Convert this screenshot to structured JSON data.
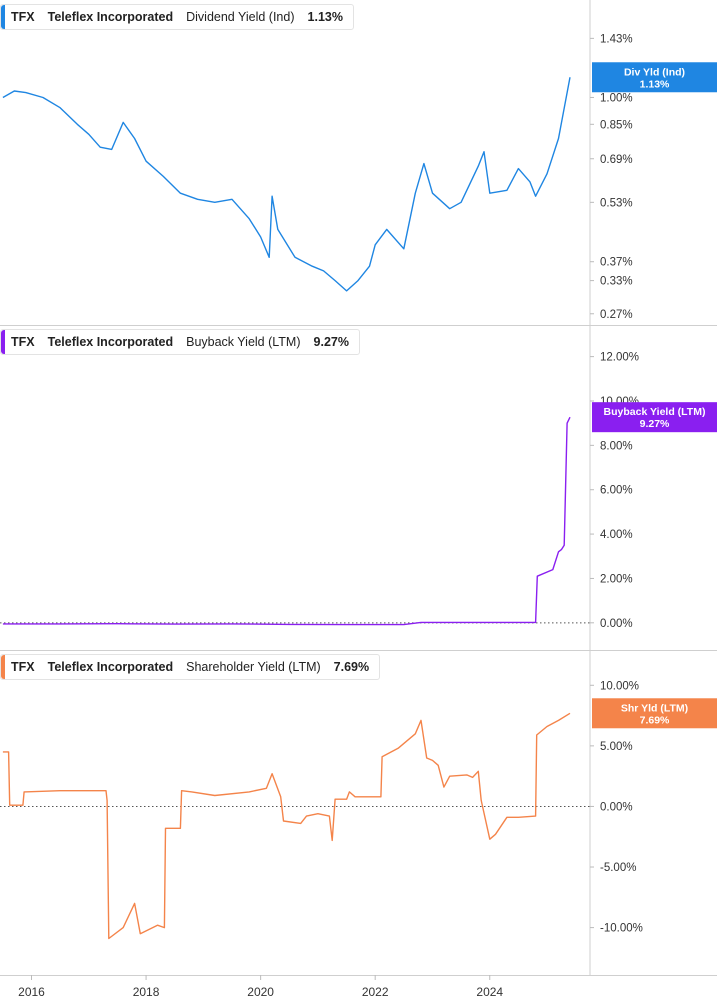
{
  "colors": {
    "dividend": "#1f86e2",
    "buyback": "#8a1ff0",
    "shareholder": "#f4844a"
  },
  "chart_data": [
    {
      "type": "line",
      "ticker": "TFX",
      "company": "Teleflex Incorporated",
      "metric": "Dividend Yield (Ind)",
      "last_value": "1.13%",
      "badge": {
        "label": "Div Yld (Ind)",
        "value": "1.13%"
      },
      "scale": "log",
      "ylim": [
        0.26,
        1.75
      ],
      "y_ticks": [
        "1.43%",
        "1.00%",
        "0.85%",
        "0.69%",
        "0.53%",
        "0.37%",
        "0.33%",
        "0.27%"
      ],
      "series": [
        {
          "x": [
            2015.5,
            2015.7,
            2015.9,
            2016.2,
            2016.5,
            2016.8,
            2017.0,
            2017.2,
            2017.4,
            2017.6,
            2017.8,
            2018.0,
            2018.3,
            2018.6,
            2018.9,
            2019.2,
            2019.5,
            2019.8,
            2020.0,
            2020.15,
            2020.2,
            2020.3,
            2020.6,
            2020.9,
            2021.1,
            2021.3,
            2021.5,
            2021.7,
            2021.9,
            2022.0,
            2022.2,
            2022.5,
            2022.7,
            2022.85,
            2023.0,
            2023.3,
            2023.5,
            2023.8,
            2023.9,
            2024.0,
            2024.3,
            2024.5,
            2024.7,
            2024.8,
            2025.0,
            2025.2,
            2025.4
          ],
          "values": [
            1.0,
            1.04,
            1.03,
            1.0,
            0.94,
            0.85,
            0.8,
            0.74,
            0.73,
            0.86,
            0.78,
            0.68,
            0.62,
            0.56,
            0.54,
            0.53,
            0.54,
            0.48,
            0.43,
            0.38,
            0.55,
            0.45,
            0.38,
            0.36,
            0.35,
            0.33,
            0.31,
            0.33,
            0.36,
            0.41,
            0.45,
            0.4,
            0.56,
            0.67,
            0.56,
            0.51,
            0.53,
            0.66,
            0.72,
            0.56,
            0.57,
            0.65,
            0.6,
            0.55,
            0.63,
            0.78,
            1.13
          ]
        }
      ]
    },
    {
      "type": "line",
      "ticker": "TFX",
      "company": "Teleflex Incorporated",
      "metric": "Buyback Yield (LTM)",
      "last_value": "9.27%",
      "badge": {
        "label": "Buyback Yield (LTM)",
        "value": "9.27%"
      },
      "ylim": [
        -1.0,
        13.2
      ],
      "y_ticks": [
        "12.00%",
        "10.00%",
        "8.00%",
        "6.00%",
        "4.00%",
        "2.00%",
        "0.00%"
      ],
      "zero_line": true,
      "series": [
        {
          "x": [
            2015.5,
            2016.5,
            2017.5,
            2018.5,
            2019.5,
            2020.5,
            2021.5,
            2022.5,
            2022.8,
            2023.5,
            2024.4,
            2024.8,
            2024.83,
            2025.1,
            2025.2,
            2025.25,
            2025.3,
            2025.35,
            2025.4
          ],
          "values": [
            -0.05,
            -0.05,
            -0.04,
            -0.06,
            -0.05,
            -0.07,
            -0.08,
            -0.08,
            0.02,
            0.02,
            0.02,
            0.02,
            2.1,
            2.4,
            3.2,
            3.3,
            3.5,
            9.0,
            9.27
          ]
        }
      ]
    },
    {
      "type": "line",
      "ticker": "TFX",
      "company": "Teleflex Incorporated",
      "metric": "Shareholder Yield (LTM)",
      "last_value": "7.69%",
      "badge": {
        "label": "Shr Yld (LTM)",
        "value": "7.69%"
      },
      "ylim": [
        -13.5,
        12.5
      ],
      "y_ticks": [
        "10.00%",
        "5.00%",
        "0.00%",
        "-5.00%",
        "-10.00%"
      ],
      "tick_values": [
        10,
        5,
        0,
        -5,
        -10
      ],
      "zero_line": true,
      "series": [
        {
          "x": [
            2015.5,
            2015.6,
            2015.62,
            2015.85,
            2015.87,
            2016.5,
            2017.3,
            2017.32,
            2017.35,
            2017.6,
            2017.8,
            2017.9,
            2018.2,
            2018.32,
            2018.34,
            2018.6,
            2018.62,
            2018.8,
            2019.2,
            2019.8,
            2020.1,
            2020.2,
            2020.35,
            2020.4,
            2020.7,
            2020.8,
            2021.0,
            2021.2,
            2021.25,
            2021.3,
            2021.5,
            2021.55,
            2021.65,
            2022.0,
            2022.1,
            2022.12,
            2022.4,
            2022.7,
            2022.8,
            2022.9,
            2023.0,
            2023.1,
            2023.2,
            2023.3,
            2023.6,
            2023.7,
            2023.8,
            2023.85,
            2024.0,
            2024.1,
            2024.3,
            2024.5,
            2024.8,
            2024.82,
            2025.0,
            2025.2,
            2025.4
          ],
          "values": [
            4.5,
            4.5,
            0.1,
            0.1,
            1.2,
            1.3,
            1.3,
            0.5,
            -10.9,
            -10.0,
            -8.0,
            -10.5,
            -9.8,
            -10.0,
            -1.8,
            -1.8,
            1.3,
            1.2,
            0.9,
            1.2,
            1.5,
            2.7,
            0.8,
            -1.2,
            -1.4,
            -0.8,
            -0.6,
            -0.8,
            -2.8,
            0.6,
            0.6,
            1.2,
            0.8,
            0.8,
            0.8,
            4.1,
            4.8,
            6.0,
            7.1,
            4.0,
            3.8,
            3.4,
            1.6,
            2.5,
            2.6,
            2.4,
            2.9,
            0.5,
            -2.7,
            -2.3,
            -0.9,
            -0.9,
            -0.8,
            5.9,
            6.6,
            7.1,
            7.69
          ]
        }
      ]
    }
  ],
  "x_axis": {
    "ticks": [
      "2016",
      "2018",
      "2020",
      "2022",
      "2024"
    ],
    "tick_values": [
      2016,
      2018,
      2020,
      2022,
      2024
    ],
    "range": [
      2015.45,
      2025.75
    ]
  }
}
